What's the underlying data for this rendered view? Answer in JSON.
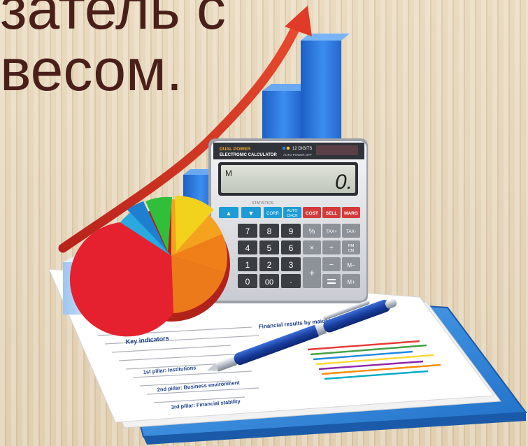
{
  "slide": {
    "title_line_1": "затель с",
    "title_line_2": "весом."
  },
  "calculator": {
    "brand_line_1": "DUAL POWER",
    "brand_line_2": "ELECTRONIC CALCULATOR",
    "digits_label": "12 DIGITS",
    "auto_power_label": "AUTO POWER OFF",
    "display_memory_indicator": "M",
    "display_value": "0.",
    "statistics_label": "STATISTICS",
    "keys": {
      "up": "▲",
      "down": "▼",
      "corr": "CORR",
      "auto_line_1": "AUTO",
      "auto_line_2": "CHCK",
      "cost": "COST",
      "sell": "SELL",
      "marg": "MARG",
      "k7": "7",
      "k8": "8",
      "k9": "9",
      "percent": "%",
      "tax_plus": "TAX+",
      "tax_minus": "TAX-",
      "k4": "4",
      "k5": "5",
      "k6": "6",
      "times": "×",
      "divide": "÷",
      "rm_line_1": "RM",
      "rm_line_2": "CM",
      "k1": "1",
      "k2": "2",
      "k3": "3",
      "plus": "+",
      "minus": "−",
      "m_minus": "M−",
      "k0": "0",
      "k00": "00",
      "dot": "·",
      "m_plus": "M+"
    }
  },
  "documents": {
    "key_indicators": "Key indicators",
    "financial_heading": "Financial results by major type",
    "pillar_1": "1st pillar: Institutions",
    "pillar_2": "2nd pillar: Business environment",
    "pillar_3": "3rd pillar: Financial stability"
  },
  "colors": {
    "title": "#4a1f1a",
    "arrow": "#d8321f",
    "bar": "#2f7be0",
    "calculator_keys_blue": "#1e9bd6",
    "calculator_keys_red": "#d53a3a",
    "clipboard": "#3a8fdc"
  }
}
